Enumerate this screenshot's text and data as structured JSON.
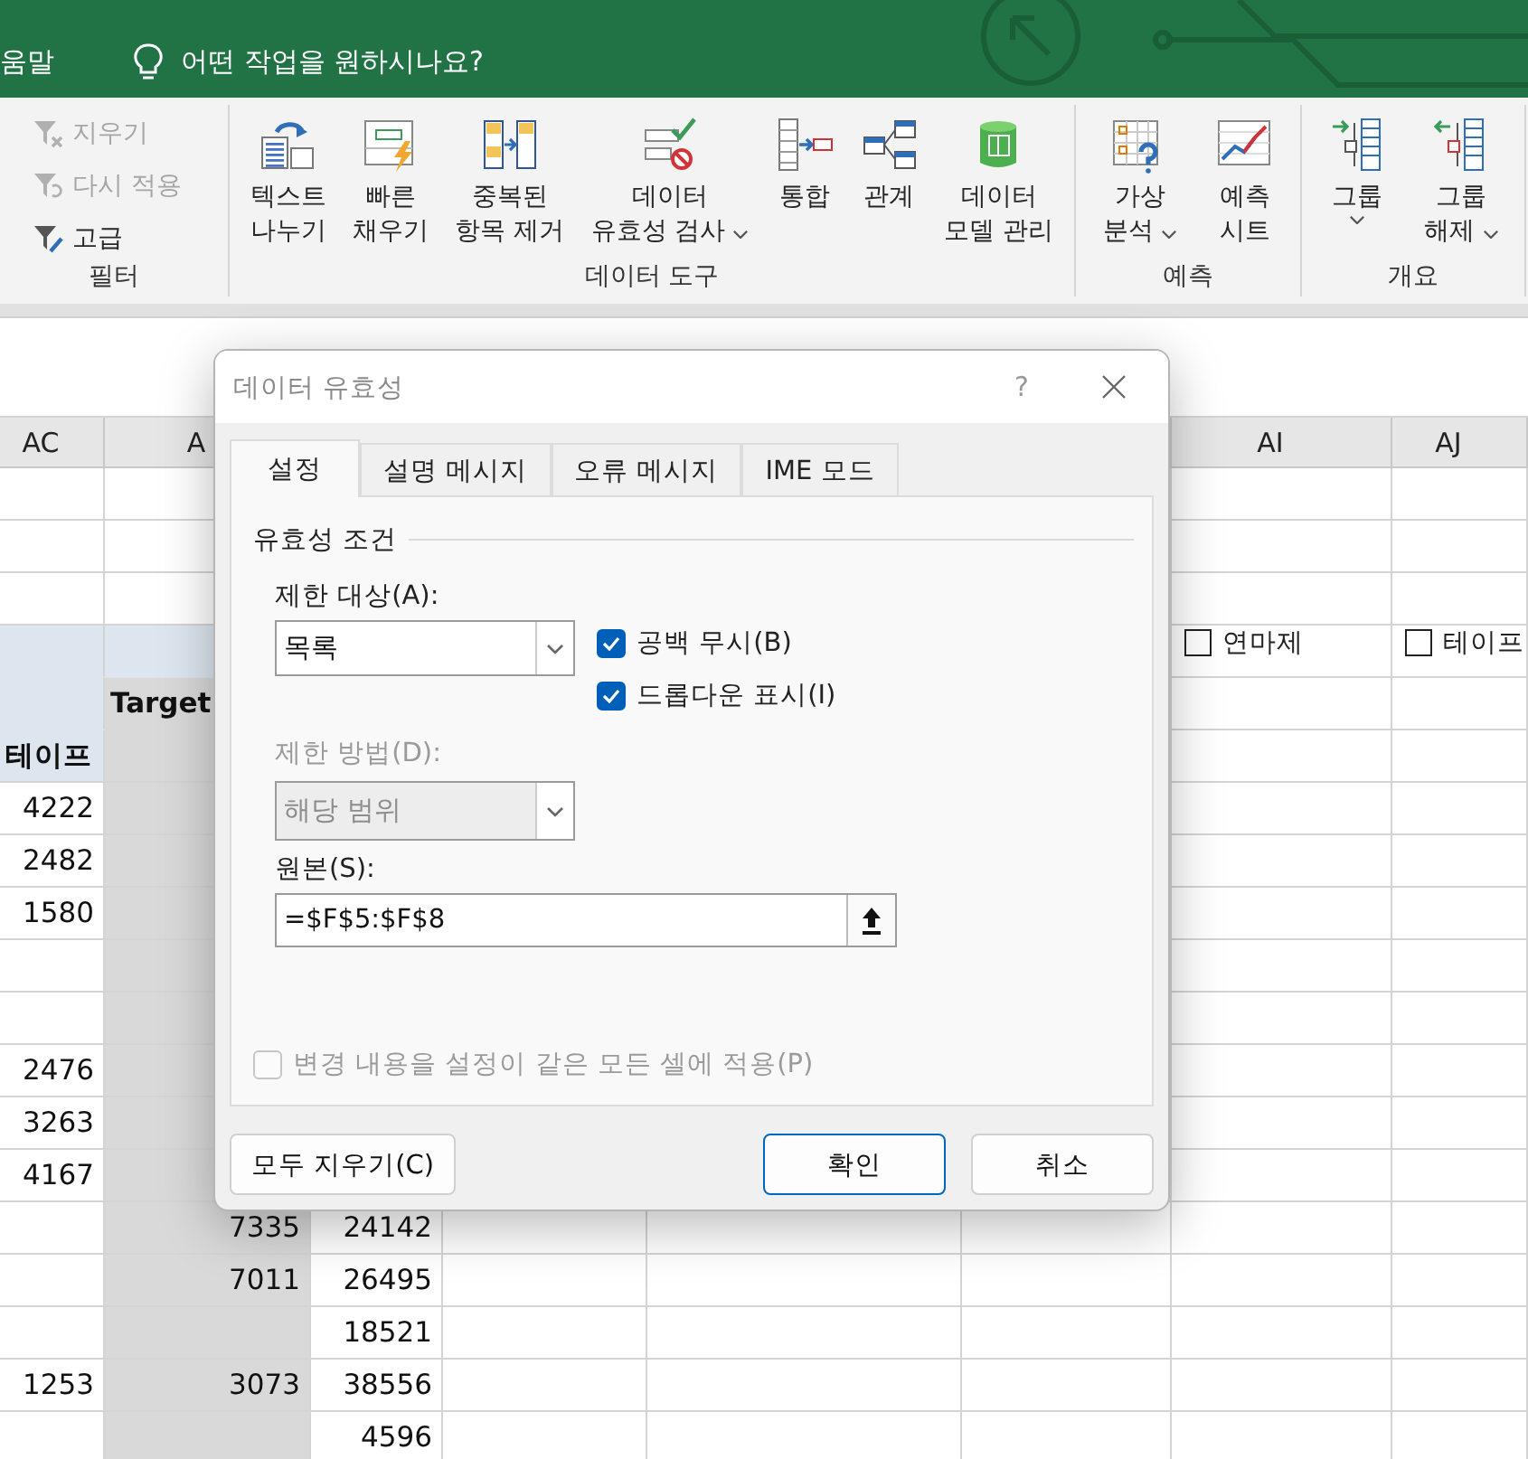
{
  "title_bar": {
    "help_tab": "움말",
    "search_placeholder": "어떤 작업을 원하시나요?"
  },
  "ribbon": {
    "groups": [
      {
        "label": "필터",
        "small_buttons": [
          {
            "label": "지우기",
            "disabled": true
          },
          {
            "label": "다시 적용",
            "disabled": true
          },
          {
            "label": "고급",
            "disabled": false
          }
        ]
      },
      {
        "label": "데이터 도구",
        "buttons": [
          {
            "lines": [
              "텍스트",
              "나누기"
            ],
            "dropdown": false
          },
          {
            "lines": [
              "빠른",
              "채우기"
            ],
            "dropdown": false
          },
          {
            "lines": [
              "중복된",
              "항목 제거"
            ],
            "dropdown": false
          },
          {
            "lines": [
              "데이터",
              "유효성 검사"
            ],
            "dropdown": true
          },
          {
            "lines": [
              "통합"
            ],
            "dropdown": false
          },
          {
            "lines": [
              "관계"
            ],
            "dropdown": false
          },
          {
            "lines": [
              "데이터",
              "모델 관리"
            ],
            "dropdown": false
          }
        ]
      },
      {
        "label": "예측",
        "buttons": [
          {
            "lines": [
              "가상",
              "분석"
            ],
            "dropdown": true
          },
          {
            "lines": [
              "예측",
              "시트"
            ],
            "dropdown": false
          }
        ]
      },
      {
        "label": "개요",
        "buttons": [
          {
            "lines": [
              "그룹"
            ],
            "dropdown": true
          },
          {
            "lines": [
              "그룹",
              "해제"
            ],
            "dropdown": true
          }
        ]
      }
    ]
  },
  "sheet": {
    "columns": [
      {
        "label": "AC"
      },
      {
        "label": "A"
      },
      {},
      {},
      {},
      {},
      {
        "label": "AI"
      },
      {
        "label": "AJ"
      }
    ],
    "rows": [
      {
        "kind": "plain"
      },
      {
        "kind": "plain"
      },
      {
        "kind": "plain"
      },
      {
        "kind": "band",
        "ai": {
          "label": "연마제",
          "checked": false
        },
        "aj": {
          "label": "테이프",
          "checked": false
        }
      },
      {
        "kind": "header",
        "ad": "Target"
      },
      {
        "kind": "header",
        "ac": "테이프"
      },
      {
        "kind": "data",
        "ac": "4222"
      },
      {
        "kind": "data",
        "ac": "2482"
      },
      {
        "kind": "data",
        "ac": "1580"
      },
      {
        "kind": "data"
      },
      {
        "kind": "data"
      },
      {
        "kind": "data",
        "ac": "2476"
      },
      {
        "kind": "data",
        "ac": "3263"
      },
      {
        "kind": "data",
        "ac": "4167"
      },
      {
        "kind": "data",
        "ad": "7335",
        "ae": "24142"
      },
      {
        "kind": "data",
        "ad": "7011",
        "ae": "26495"
      },
      {
        "kind": "data",
        "ae": "18521"
      },
      {
        "kind": "data",
        "ac": "1253",
        "ad": "3073",
        "ae": "38556"
      },
      {
        "kind": "data",
        "ae": "4596"
      }
    ]
  },
  "dialog": {
    "title": "데이터 유효성",
    "help": "?",
    "tabs": [
      {
        "label": "설정",
        "selected": true
      },
      {
        "label": "설명 메시지",
        "selected": false
      },
      {
        "label": "오류 메시지",
        "selected": false
      },
      {
        "label": "IME 모드",
        "selected": false
      }
    ],
    "group_title": "유효성 조건",
    "allow_label": "제한 대상(A):",
    "allow_value": "목록",
    "ignore_blank": {
      "label": "공백 무시(B)",
      "checked": true
    },
    "in_cell_dropdown": {
      "label": "드롭다운 표시(I)",
      "checked": true
    },
    "data_label": "제한 방법(D):",
    "data_value": "해당 범위",
    "data_disabled": true,
    "source_label": "원본(S):",
    "source_value": "=$F$5:$F$8",
    "apply_all": {
      "label": "변경 내용을 설정이 같은 모든 셀에 적용(P)",
      "checked": false,
      "disabled": true
    },
    "clear_button": "모두 지우기(C)",
    "ok_button": "확인",
    "cancel_button": "취소"
  }
}
